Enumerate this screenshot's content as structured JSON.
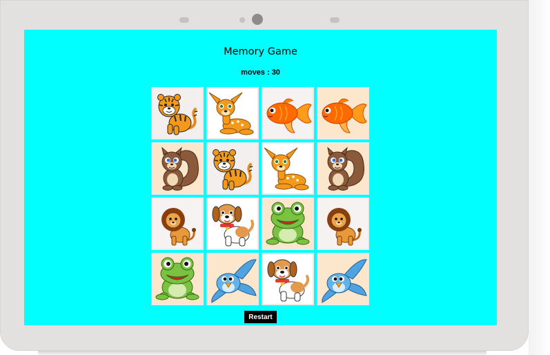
{
  "game": {
    "title": "Memory Game",
    "moves_text": "moves : 30",
    "restart_label": "Restart"
  },
  "board": {
    "columns": 4,
    "rows": 4,
    "cards": [
      {
        "animal": "tiger",
        "background": "#f3efef"
      },
      {
        "animal": "deer",
        "background": "#ffffff"
      },
      {
        "animal": "goldfish",
        "background": "#f6f2f2"
      },
      {
        "animal": "goldfish",
        "background": "#fde7cc"
      },
      {
        "animal": "squirrel",
        "background": "#fde7cc"
      },
      {
        "animal": "tiger",
        "background": "#f3efef"
      },
      {
        "animal": "deer",
        "background": "#ffffff"
      },
      {
        "animal": "squirrel",
        "background": "#fde7cc"
      },
      {
        "animal": "lion",
        "background": "#f6f2f2"
      },
      {
        "animal": "dog",
        "background": "#ffffff"
      },
      {
        "animal": "frog",
        "background": "#fde7cc"
      },
      {
        "animal": "lion",
        "background": "#f6f2f2"
      },
      {
        "animal": "frog",
        "background": "#fde7cc"
      },
      {
        "animal": "bird",
        "background": "#fde7cc"
      },
      {
        "animal": "dog",
        "background": "#ffffff"
      },
      {
        "animal": "bird",
        "background": "#fde7cc"
      }
    ]
  },
  "colors": {
    "screen_background": "#00ffff",
    "device_bezel": "#e2e1e0",
    "restart_background": "#000000",
    "restart_text": "#ffffff"
  }
}
